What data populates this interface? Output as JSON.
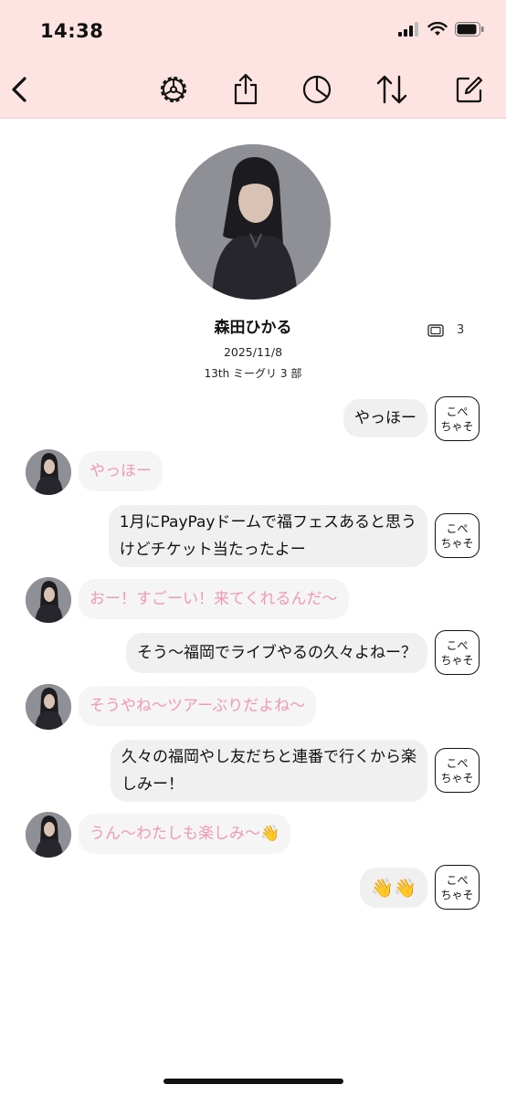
{
  "status": {
    "time": "14:38"
  },
  "toolbar": {
    "back": "back-icon",
    "settings": "gear-icon",
    "share": "share-icon",
    "stats": "pie-chart-icon",
    "sort": "sort-arrows-icon",
    "compose": "compose-icon"
  },
  "profile": {
    "name": "森田ひかる",
    "date": "2025/11/8",
    "event": "13th ミーグリ 3 部",
    "ticket_count": "3"
  },
  "copy_label": [
    "こぺ",
    "ちゃそ"
  ],
  "messages": [
    {
      "side": "out",
      "text": "やっほー"
    },
    {
      "side": "in",
      "text": "やっほー"
    },
    {
      "side": "out",
      "lines": [
        "1月にPayPayドームで福フェスあると思う",
        "けどチケット当たったよー"
      ]
    },
    {
      "side": "in",
      "text": "おー！すごーい！来てくれるんだ〜"
    },
    {
      "side": "out",
      "text": "そう〜福岡でライブやるの久々よねー？"
    },
    {
      "side": "in",
      "text": "そうやね〜ツアーぶりだよね〜"
    },
    {
      "side": "out",
      "lines": [
        "久々の福岡やし友だちと連番で行くから楽",
        "しみー！"
      ]
    },
    {
      "side": "in",
      "text": "うん〜わたしも楽しみ〜👋"
    },
    {
      "side": "out",
      "text": "👋👋"
    }
  ],
  "colors": {
    "header_bg": "#fde3e1",
    "incoming_text": "#f09ab0",
    "bubble_bg": "#f0f0f0"
  }
}
